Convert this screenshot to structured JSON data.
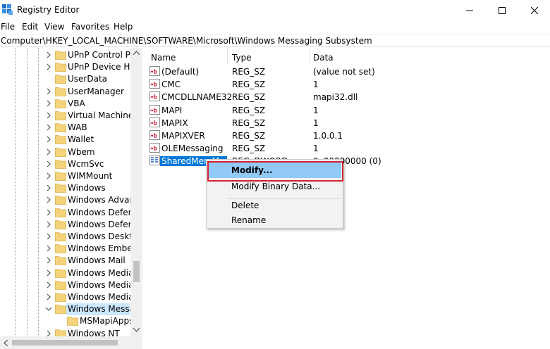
{
  "window": {
    "title": "Registry Editor",
    "controls": {
      "minimize_icon": "minimize-icon",
      "maximize_icon": "maximize-icon",
      "close_icon": "close-icon"
    }
  },
  "menu": [
    "File",
    "Edit",
    "View",
    "Favorites",
    "Help"
  ],
  "address": "Computer\\HKEY_LOCAL_MACHINE\\SOFTWARE\\Microsoft\\Windows Messaging Subsystem",
  "tree": [
    {
      "label": "UPnP Control Poi",
      "expander": "chevron-right"
    },
    {
      "label": "UPnP Device Hos",
      "expander": "chevron-right"
    },
    {
      "label": "UserData",
      "expander": "none"
    },
    {
      "label": "UserManager",
      "expander": "chevron-right"
    },
    {
      "label": "VBA",
      "expander": "chevron-right"
    },
    {
      "label": "Virtual Machine",
      "expander": "chevron-right"
    },
    {
      "label": "WAB",
      "expander": "chevron-right"
    },
    {
      "label": "Wallet",
      "expander": "chevron-right"
    },
    {
      "label": "Wbem",
      "expander": "chevron-right"
    },
    {
      "label": "WcmSvc",
      "expander": "chevron-right"
    },
    {
      "label": "WIMMount",
      "expander": "chevron-right"
    },
    {
      "label": "Windows",
      "expander": "chevron-right"
    },
    {
      "label": "Windows Advanc",
      "expander": "chevron-right"
    },
    {
      "label": "Windows Defend",
      "expander": "chevron-right"
    },
    {
      "label": "Windows Defend",
      "expander": "chevron-right"
    },
    {
      "label": "Windows Desktop",
      "expander": "chevron-right"
    },
    {
      "label": "Windows Embedd",
      "expander": "chevron-right"
    },
    {
      "label": "Windows Mail",
      "expander": "chevron-right"
    },
    {
      "label": "Windows Media D",
      "expander": "chevron-right"
    },
    {
      "label": "Windows Media F",
      "expander": "chevron-right"
    },
    {
      "label": "Windows Media P",
      "expander": "chevron-right"
    },
    {
      "label": "Windows Messag",
      "expander": "chevron-down",
      "selected": true
    },
    {
      "label": "MSMapiApps",
      "expander": "none",
      "child": true
    },
    {
      "label": "Windows NT",
      "expander": "chevron-right"
    }
  ],
  "columns": {
    "name": "Name",
    "type": "Type",
    "data": "Data"
  },
  "values": [
    {
      "icon": "string-value-icon",
      "name": "(Default)",
      "type": "REG_SZ",
      "data": "(value not set)"
    },
    {
      "icon": "string-value-icon",
      "name": "CMC",
      "type": "REG_SZ",
      "data": "1"
    },
    {
      "icon": "string-value-icon",
      "name": "CMCDLLNAME32",
      "type": "REG_SZ",
      "data": "mapi32.dll"
    },
    {
      "icon": "string-value-icon",
      "name": "MAPI",
      "type": "REG_SZ",
      "data": "1"
    },
    {
      "icon": "string-value-icon",
      "name": "MAPIX",
      "type": "REG_SZ",
      "data": "1"
    },
    {
      "icon": "string-value-icon",
      "name": "MAPIXVER",
      "type": "REG_SZ",
      "data": "1.0.0.1"
    },
    {
      "icon": "string-value-icon",
      "name": "OLEMessaging",
      "type": "REG_SZ",
      "data": "1"
    },
    {
      "icon": "dword-value-icon",
      "name": "SharedMemM...",
      "type": "REG_DWORD",
      "data": "0x00000000 (0)",
      "selected": true
    }
  ],
  "context_menu": {
    "modify": "Modify...",
    "modify_binary": "Modify Binary Data...",
    "delete": "Delete",
    "rename": "Rename"
  },
  "colors": {
    "selection": "#0078d7",
    "menu_hover": "#91c9f7",
    "highlight_box": "#d4202a",
    "folder": "#f4d37a"
  }
}
